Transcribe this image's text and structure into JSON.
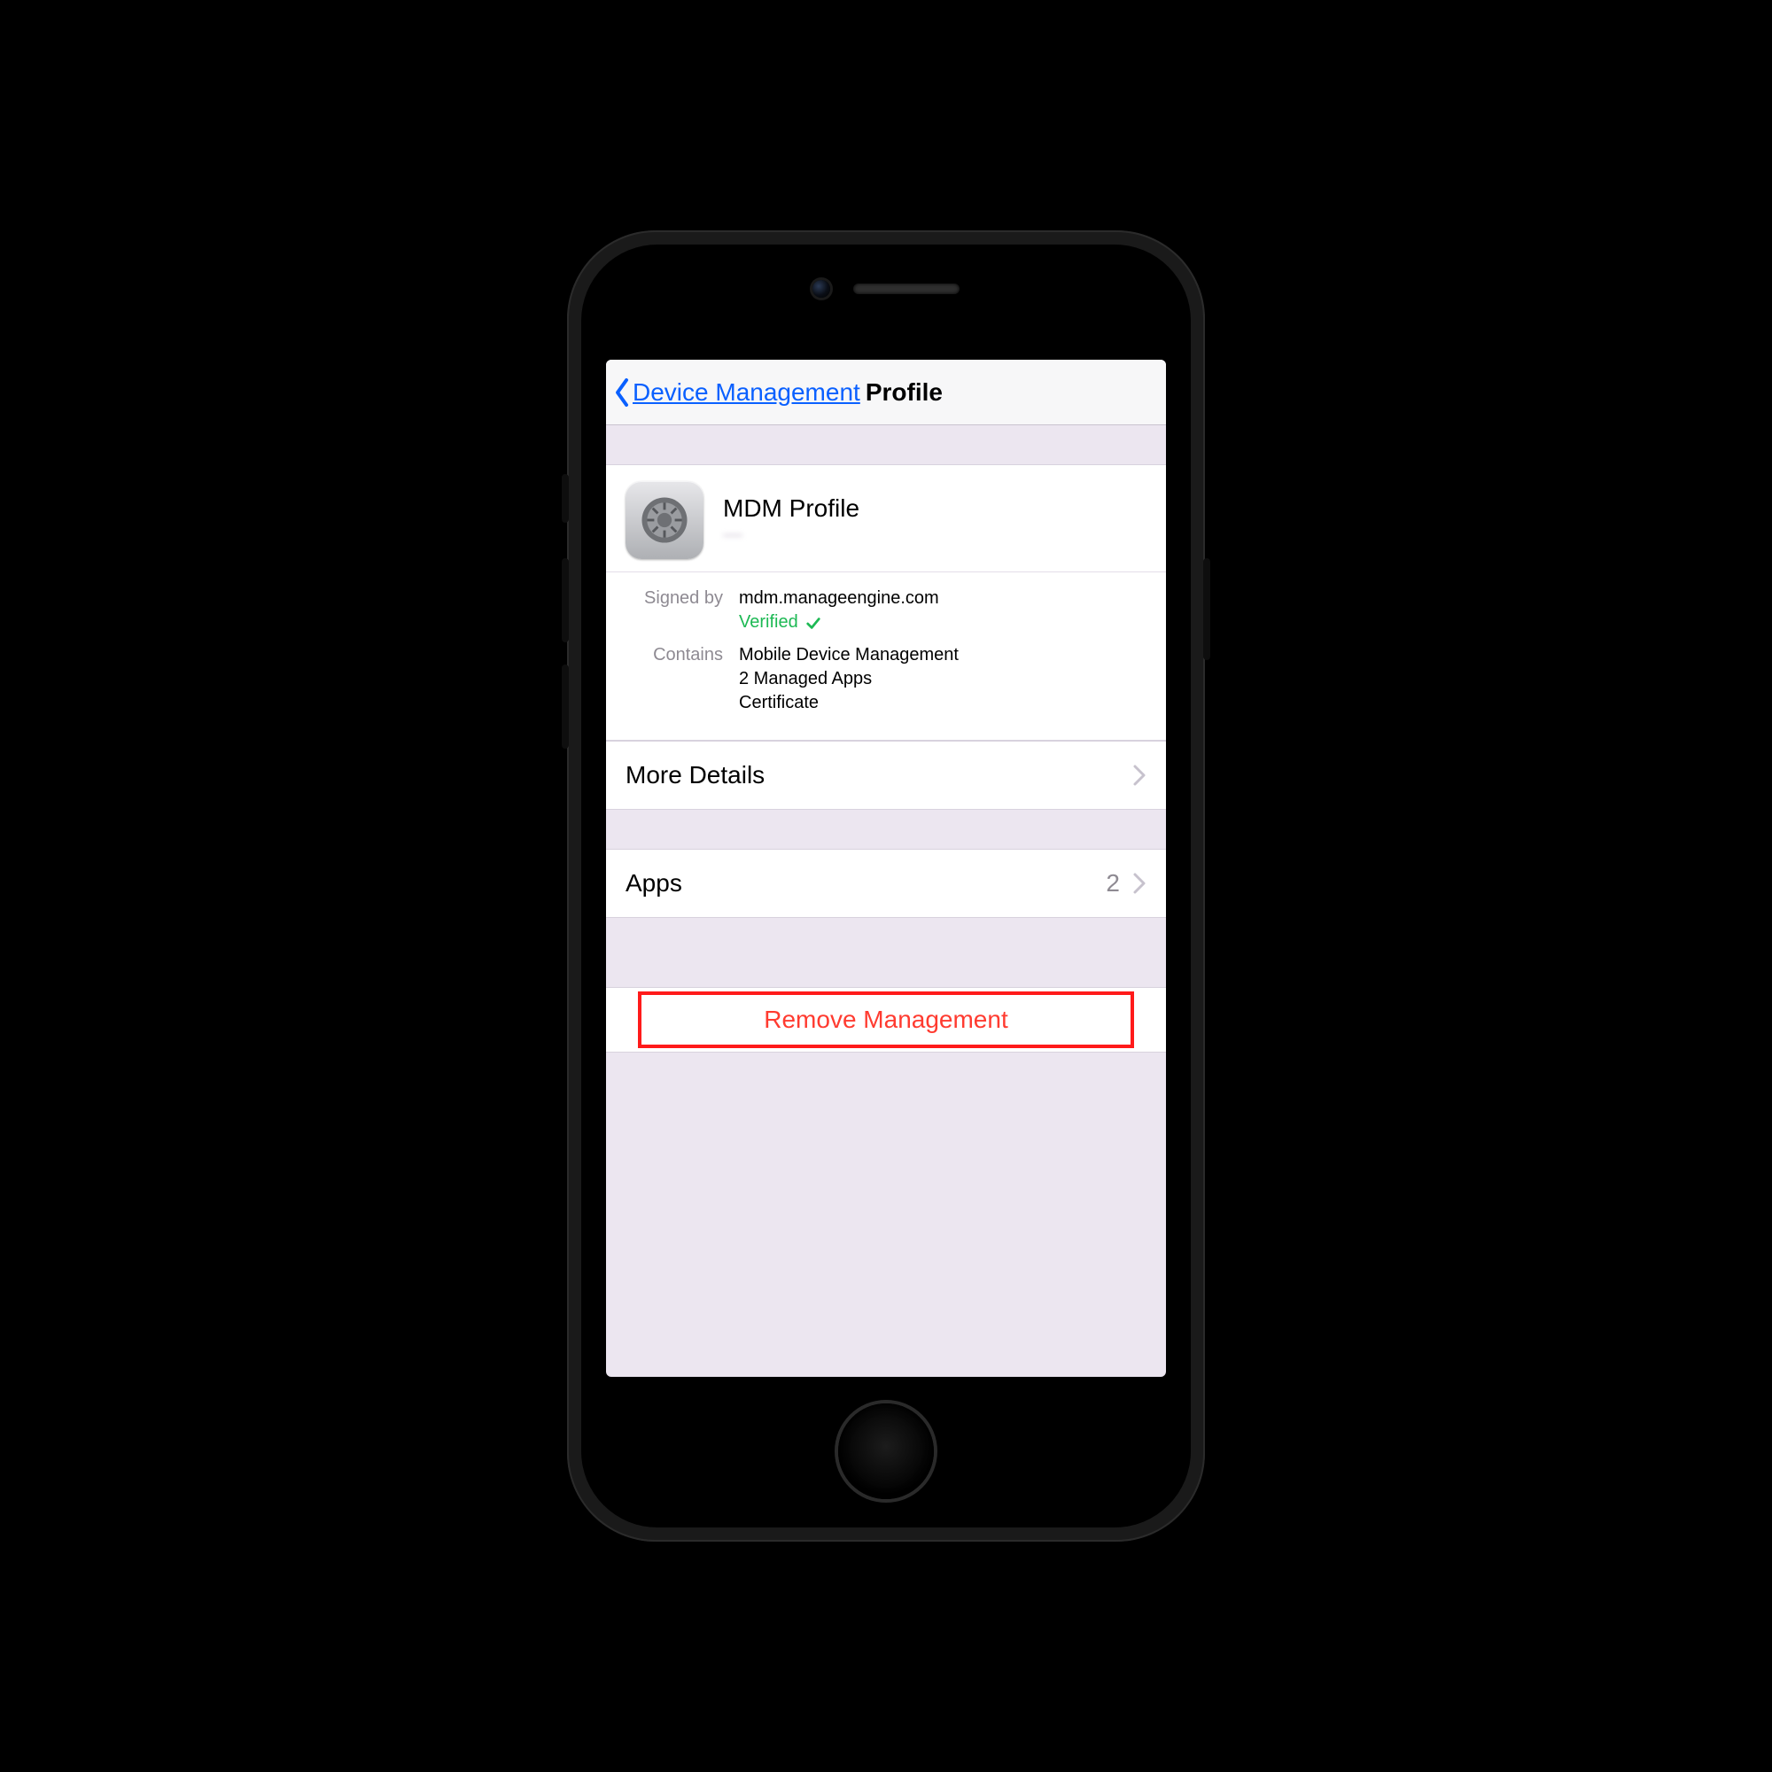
{
  "nav": {
    "back_label": "Device Management",
    "title": "Profile"
  },
  "profile": {
    "name": "MDM Profile",
    "org": "—",
    "signed_by_label": "Signed by",
    "signed_by": "mdm.manageengine.com",
    "verified_label": "Verified",
    "contains_label": "Contains",
    "contains": [
      "Mobile Device Management",
      "2 Managed Apps",
      "Certificate"
    ]
  },
  "rows": {
    "more_details": "More Details",
    "apps_label": "Apps",
    "apps_count": "2"
  },
  "remove": {
    "label": "Remove Management"
  }
}
